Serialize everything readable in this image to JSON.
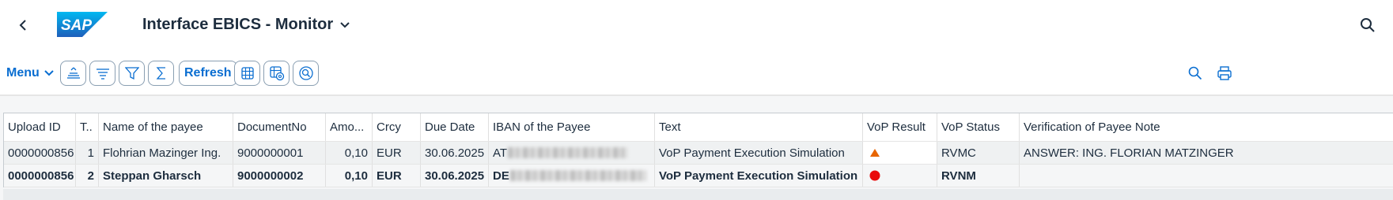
{
  "shell": {
    "title": "Interface EBICS - Monitor",
    "logo_text": "SAP"
  },
  "toolbar": {
    "menu_label": "Menu",
    "refresh_label": "Refresh"
  },
  "colors": {
    "accent": "#0a6ed1",
    "warning": "#e76500",
    "error": "#e90b0b"
  },
  "table": {
    "columns": [
      "Upload ID",
      "T..",
      "Name of the payee",
      "DocumentNo",
      "Amo...",
      "Crcy",
      "Due Date",
      "IBAN of the Payee",
      "Text",
      "VoP Result",
      "VoP Status",
      "Verification of Payee Note"
    ],
    "rows": [
      {
        "upload_id": "0000000856",
        "t": "1",
        "payee": "Flohrian Mazinger Ing.",
        "document_no": "9000000001",
        "amount": "0,10",
        "currency": "EUR",
        "due_date": "30.06.2025",
        "iban_prefix": "AT",
        "text": "VoP Payment Execution Simulation",
        "vop_result_icon": "warning-triangle-icon",
        "vop_status": "RVMC",
        "vop_note": "ANSWER: ING. FLORIAN MATZINGER"
      },
      {
        "upload_id": "0000000856",
        "t": "2",
        "payee": "Steppan Gharsch",
        "document_no": "9000000002",
        "amount": "0,10",
        "currency": "EUR",
        "due_date": "30.06.2025",
        "iban_prefix": "DE",
        "text": "VoP Payment Execution Simulation",
        "vop_result_icon": "error-circle-icon",
        "vop_status": "RVNM",
        "vop_note": ""
      }
    ]
  }
}
